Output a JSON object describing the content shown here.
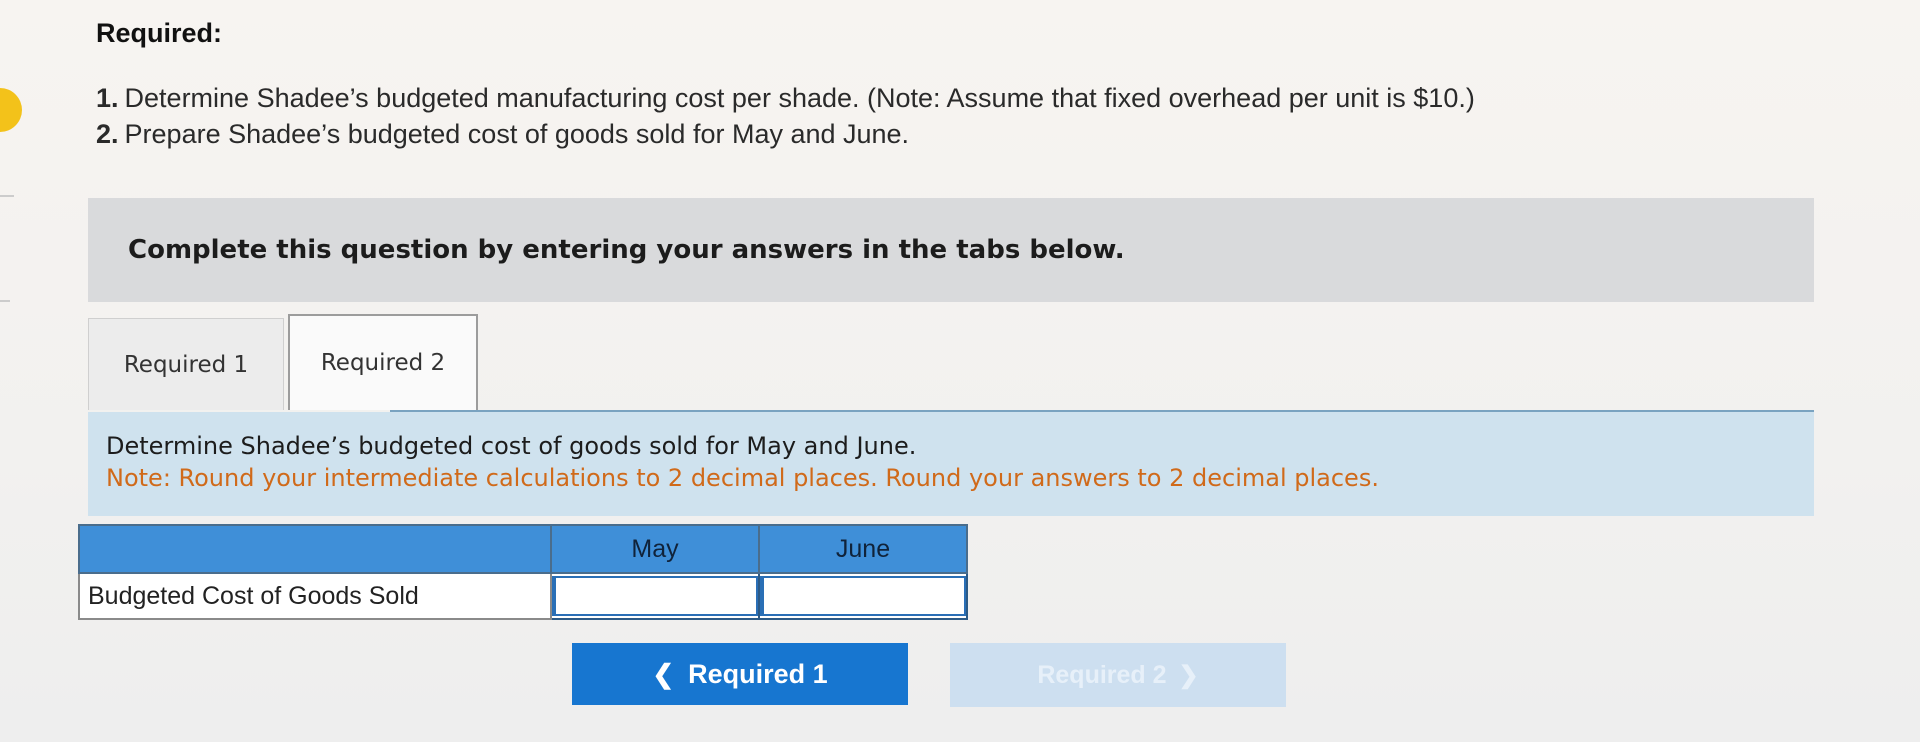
{
  "assignment": {
    "heading": "Required:",
    "requirements": [
      {
        "number": "1.",
        "text": "Determine Shadee’s budgeted manufacturing cost per shade. (Note: Assume that fixed overhead per unit is $10.)"
      },
      {
        "number": "2.",
        "text": "Prepare Shadee’s budgeted cost of goods sold for May and June."
      }
    ]
  },
  "instruction": "Complete this question by entering your answers in the tabs below.",
  "tabs": [
    {
      "label": "Required 1",
      "active": false
    },
    {
      "label": "Required 2",
      "active": true
    }
  ],
  "question": {
    "text": "Determine Shadee’s budgeted cost of goods sold for May and June.",
    "note": "Note: Round your intermediate calculations to 2 decimal places. Round your answers to 2 decimal places."
  },
  "table": {
    "columns": [
      "May",
      "June"
    ],
    "rows": [
      {
        "label": "Budgeted Cost of Goods Sold",
        "may": "",
        "june": ""
      }
    ]
  },
  "navigation": {
    "prev_label": "Required 1",
    "next_label": "Required 2",
    "prev_icon": "chevron-left-icon",
    "next_icon": "chevron-right-icon"
  },
  "colors": {
    "accent": "#1776d0",
    "table_header": "#3f8fd8",
    "note": "#d06a1a",
    "question_panel": "#cfe2ee"
  }
}
